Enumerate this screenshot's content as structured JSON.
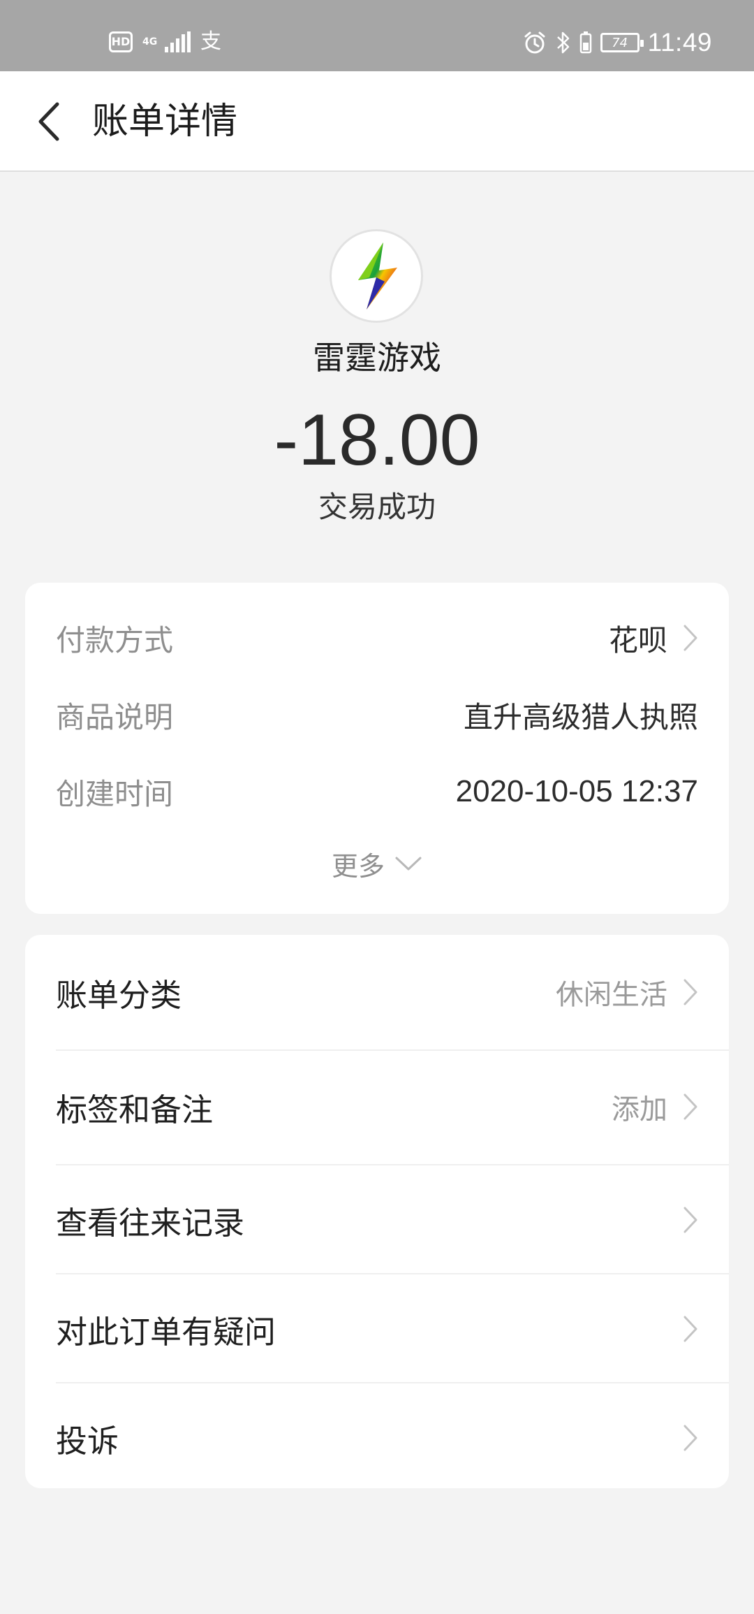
{
  "status_bar": {
    "hd": "HD",
    "network": "4G",
    "app_icon": "支",
    "battery": "74",
    "time": "11:49"
  },
  "header": {
    "title": "账单详情"
  },
  "merchant": {
    "name": "雷霆游戏",
    "amount": "-18.00",
    "status": "交易成功"
  },
  "details": {
    "payment_method_label": "付款方式",
    "payment_method_value": "花呗",
    "product_label": "商品说明",
    "product_value": "直升高级猎人执照",
    "created_label": "创建时间",
    "created_value": "2020-10-05 12:37",
    "more_label": "更多"
  },
  "actions": [
    {
      "label": "账单分类",
      "value": "休闲生活"
    },
    {
      "label": "标签和备注",
      "value": "添加"
    },
    {
      "label": "查看往来记录",
      "value": ""
    },
    {
      "label": "对此订单有疑问",
      "value": ""
    },
    {
      "label": "投诉",
      "value": ""
    }
  ]
}
